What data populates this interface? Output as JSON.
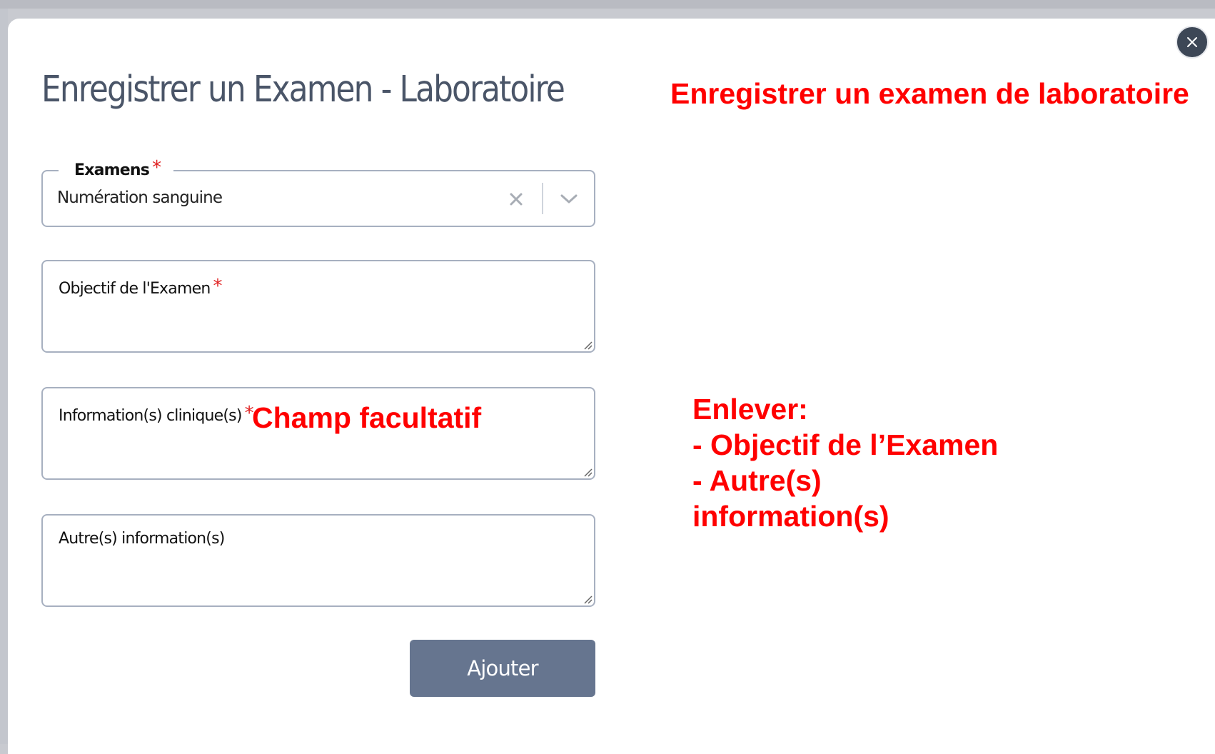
{
  "modal": {
    "title": "Enregistrer un Examen - Laboratoire",
    "close_icon": "close-icon"
  },
  "form": {
    "exams": {
      "label": "Examens",
      "required_mark": "*",
      "value": "Numération sanguine",
      "clear_icon": "x-icon",
      "dropdown_icon": "chevron-down-icon"
    },
    "objective": {
      "label": "Objectif de l'Examen",
      "required_mark": "*",
      "value": ""
    },
    "clinical_info": {
      "label": "Information(s) clinique(s)",
      "required_mark": "*",
      "value": ""
    },
    "other_info": {
      "label": "Autre(s) information(s)",
      "value": ""
    },
    "submit_label": "Ajouter"
  },
  "annotations": {
    "title_note": "Enregistrer un examen de laboratoire",
    "optional_note": "Champ facultatif",
    "remove_lines": [
      "Enlever:",
      "- Objectif de l’Examen",
      "- Autre(s)",
      "information(s)"
    ]
  },
  "colors": {
    "title": "#4a5568",
    "annotation": "#ff0000",
    "required": "#e02424",
    "button": "#66758f",
    "field_border": "#a7b0c0",
    "close_button": "#3d4756"
  }
}
